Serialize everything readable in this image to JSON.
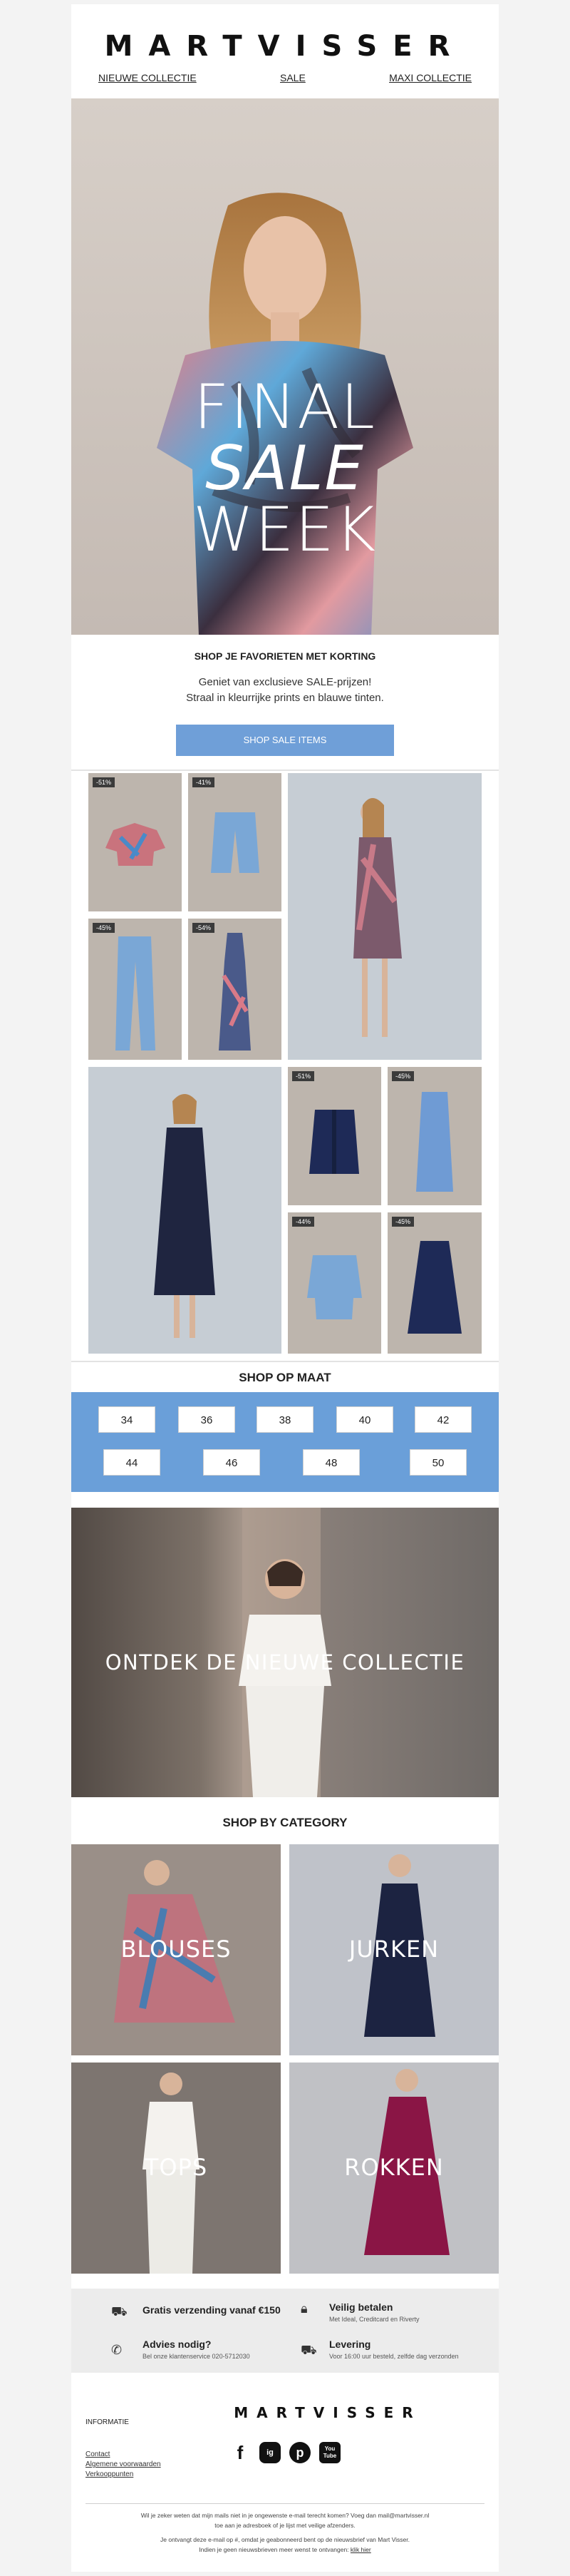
{
  "brand": "MARTVISSER",
  "nav": [
    "NIEUWE COLLECTIE",
    "SALE",
    "MAXI COLLECTIE"
  ],
  "hero": {
    "line1": "FINAL",
    "line2": "SALE",
    "line3": "WEEK"
  },
  "intro": {
    "title": "SHOP JE FAVORIETEN MET KORTING",
    "line1": "Geniet van exclusieve SALE-prijzen!",
    "line2": "Straal in kleurrijke prints en blauwe tinten.",
    "cta": "SHOP SALE ITEMS"
  },
  "products": [
    "-51%",
    "-41%",
    "-45%",
    "-54%",
    "-51%",
    "-45%",
    "-44%",
    "-45%"
  ],
  "sizes": {
    "title": "SHOP OP MAAT",
    "row1": [
      "34",
      "36",
      "38",
      "40",
      "42"
    ],
    "row2": [
      "44",
      "46",
      "48",
      "50"
    ]
  },
  "banner": "ONTDEK DE NIEUWE COLLECTIE",
  "categories": {
    "title": "SHOP BY CATEGORY",
    "items": [
      "BLOUSES",
      "JURKEN",
      "TOPS",
      "ROKKEN"
    ]
  },
  "usps": [
    {
      "title": "Gratis verzending vanaf €150",
      "sub": "",
      "icon": "truck-icon"
    },
    {
      "title": "Veilig betalen",
      "sub": "Met Ideal, Creditcard en Riverty",
      "icon": "lock-icon"
    },
    {
      "title": "Advies nodig?",
      "sub": "Bel onze klantenservice 020-5712030",
      "icon": "phone-icon"
    },
    {
      "title": "Levering",
      "sub": "Voor 16:00 uur besteld, zelfde dag verzonden",
      "icon": "delivery-icon"
    }
  ],
  "footer": {
    "info_label": "INFORMATIE",
    "links": [
      "Contact",
      "Algemene voorwaarden",
      "Verkooppunten"
    ],
    "social": [
      "f",
      "ig",
      "p",
      "You Tube"
    ],
    "note1": "Wil je zeker weten dat mijn mails niet in je ongewenste e-mail terecht komen? Voeg dan mail@martvisser.nl",
    "note2": "toe aan je adresboek of je lijst met veilige afzenders.",
    "note3": "Je ontvangt deze e-mail op #, omdat je geabonneerd bent op de nieuwsbrief van Mart Visser.",
    "note4": "Indien je geen nieuwsbrieven meer wenst te ontvangen:",
    "unsubscribe": "klik hier"
  }
}
